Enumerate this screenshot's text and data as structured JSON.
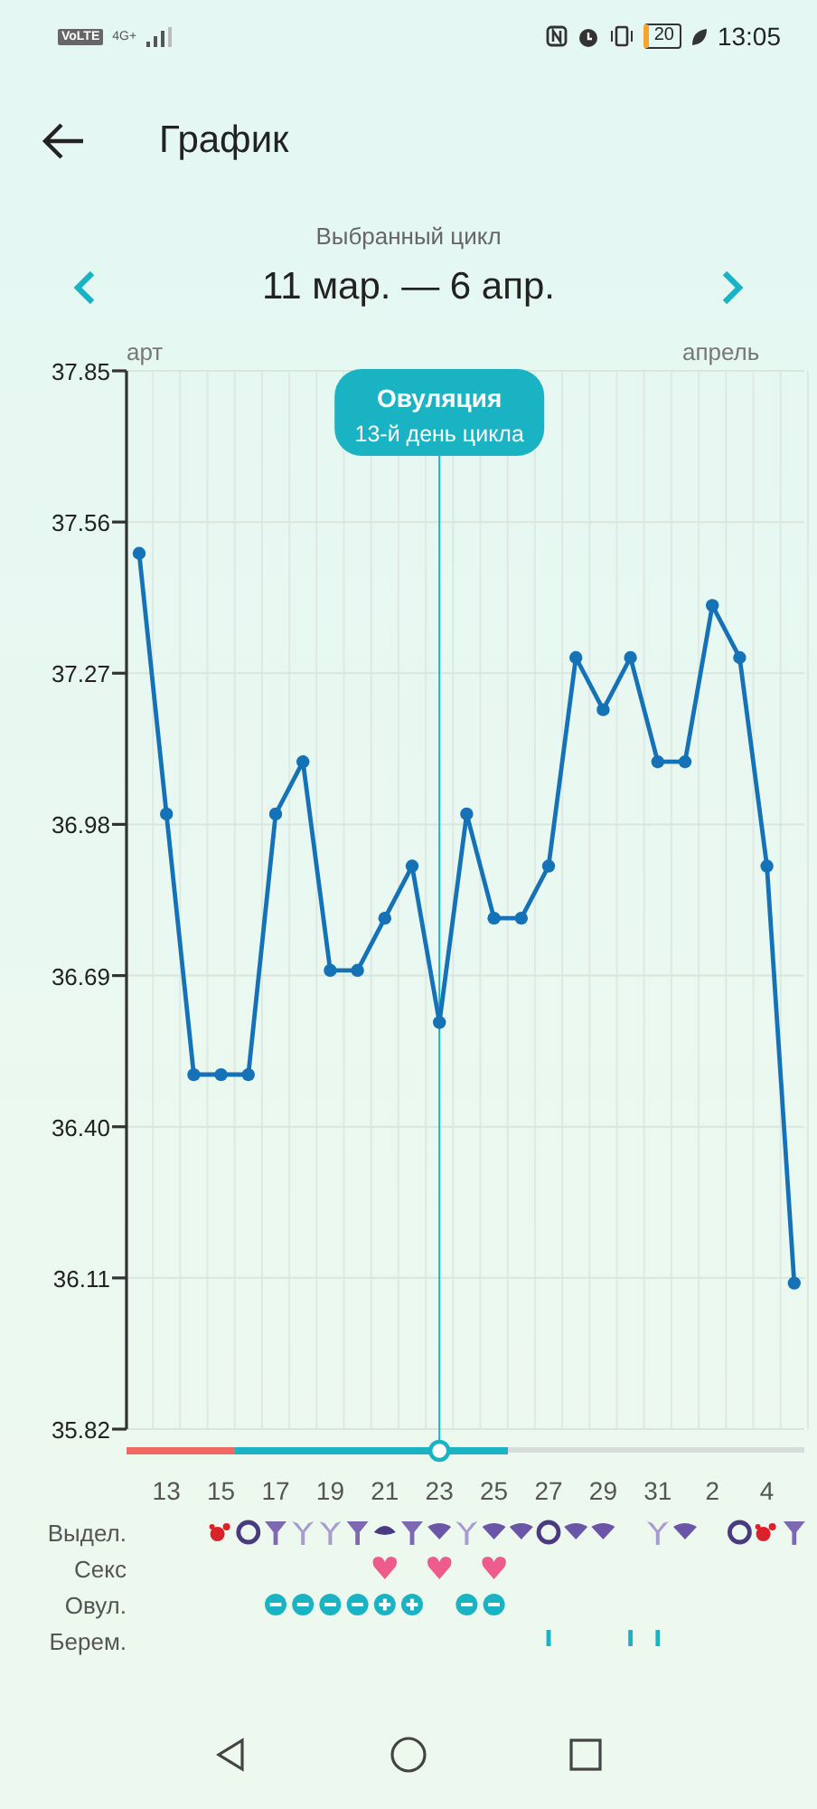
{
  "status_bar": {
    "network_badge": "VoLTE",
    "network_type": "4G+",
    "battery": "20",
    "time": "13:05"
  },
  "header": {
    "title": "График"
  },
  "cycle_selector": {
    "caption": "Выбранный цикл",
    "range": "11 мар. — 6 апр."
  },
  "chart": {
    "month_labels": [
      "арт",
      "апрель"
    ],
    "cycle_bar": [
      {
        "kind": "period"
      },
      {
        "kind": "fertile"
      },
      {
        "kind": "rest"
      }
    ],
    "chart_data": {
      "type": "line",
      "categories": [
        null,
        "13",
        null,
        "15",
        null,
        "17",
        null,
        "19",
        null,
        "21",
        null,
        "23",
        null,
        "25",
        null,
        "27",
        null,
        "29",
        null,
        "31",
        null,
        "2",
        null,
        "4",
        null
      ],
      "ylim": [
        35.82,
        37.85
      ],
      "yticks": [
        {
          "value": 35.82,
          "label": "35.82"
        },
        {
          "value": 36.11,
          "label": "36.11"
        },
        {
          "value": 36.4,
          "label": "36.40"
        },
        {
          "value": 36.69,
          "label": "36.69"
        },
        {
          "value": 36.98,
          "label": "36.98"
        },
        {
          "value": 37.27,
          "label": "37.27"
        },
        {
          "value": 37.56,
          "label": "37.56"
        },
        {
          "value": 37.85,
          "label": "37.85"
        }
      ],
      "grid": true,
      "series": [
        {
          "color": "#1572b6",
          "marker": true,
          "values": [
            37.5,
            37.0,
            36.5,
            36.5,
            36.5,
            37.0,
            37.1,
            36.7,
            36.7,
            36.8,
            36.9,
            36.6,
            37.0,
            36.8,
            36.8,
            36.9,
            37.3,
            37.2,
            37.3,
            37.1,
            37.1,
            37.4,
            37.3,
            36.9,
            36.1
          ]
        }
      ],
      "annotations": [
        "Овуляция",
        "13-й день цикла"
      ]
    }
  },
  "symbol_rows": [
    {
      "label": "Выдел.",
      "cells": [
        {
          "kind": "none"
        },
        {
          "kind": "none"
        },
        {
          "kind": "none"
        },
        {
          "kind": "blood"
        },
        {
          "kind": "ring"
        },
        {
          "kind": "funnel"
        },
        {
          "kind": "funnel_light"
        },
        {
          "kind": "funnel_light"
        },
        {
          "kind": "funnel"
        },
        {
          "kind": "lens"
        },
        {
          "kind": "funnel"
        },
        {
          "kind": "drop"
        },
        {
          "kind": "funnel_light"
        },
        {
          "kind": "drop"
        },
        {
          "kind": "drop"
        },
        {
          "kind": "ring"
        },
        {
          "kind": "drop"
        },
        {
          "kind": "drop"
        },
        {
          "kind": "none"
        },
        {
          "kind": "funnel_light"
        },
        {
          "kind": "drop"
        },
        {
          "kind": "none"
        },
        {
          "kind": "ring"
        },
        {
          "kind": "blood"
        },
        {
          "kind": "funnel"
        }
      ]
    },
    {
      "label": "Секс",
      "cells": [
        {
          "kind": "none"
        },
        {
          "kind": "none"
        },
        {
          "kind": "none"
        },
        {
          "kind": "none"
        },
        {
          "kind": "none"
        },
        {
          "kind": "none"
        },
        {
          "kind": "none"
        },
        {
          "kind": "none"
        },
        {
          "kind": "none"
        },
        {
          "kind": "heart"
        },
        {
          "kind": "none"
        },
        {
          "kind": "heart"
        },
        {
          "kind": "none"
        },
        {
          "kind": "heart"
        },
        {
          "kind": "none"
        },
        {
          "kind": "none"
        },
        {
          "kind": "none"
        },
        {
          "kind": "none"
        },
        {
          "kind": "none"
        },
        {
          "kind": "none"
        },
        {
          "kind": "none"
        },
        {
          "kind": "none"
        },
        {
          "kind": "none"
        },
        {
          "kind": "none"
        },
        {
          "kind": "none"
        }
      ]
    },
    {
      "label": "Овул.",
      "cells": [
        {
          "kind": "none"
        },
        {
          "kind": "none"
        },
        {
          "kind": "none"
        },
        {
          "kind": "none"
        },
        {
          "kind": "none"
        },
        {
          "kind": "negative"
        },
        {
          "kind": "negative"
        },
        {
          "kind": "negative"
        },
        {
          "kind": "negative"
        },
        {
          "kind": "positive"
        },
        {
          "kind": "positive"
        },
        {
          "kind": "none"
        },
        {
          "kind": "negative"
        },
        {
          "kind": "negative"
        },
        {
          "kind": "none"
        },
        {
          "kind": "none"
        },
        {
          "kind": "none"
        },
        {
          "kind": "none"
        },
        {
          "kind": "none"
        },
        {
          "kind": "none"
        },
        {
          "kind": "none"
        },
        {
          "kind": "none"
        },
        {
          "kind": "none"
        },
        {
          "kind": "none"
        },
        {
          "kind": "none"
        }
      ]
    },
    {
      "label": "Берем.",
      "cells": [
        {
          "kind": "none"
        },
        {
          "kind": "none"
        },
        {
          "kind": "none"
        },
        {
          "kind": "none"
        },
        {
          "kind": "none"
        },
        {
          "kind": "none"
        },
        {
          "kind": "none"
        },
        {
          "kind": "none"
        },
        {
          "kind": "none"
        },
        {
          "kind": "none"
        },
        {
          "kind": "none"
        },
        {
          "kind": "none"
        },
        {
          "kind": "none"
        },
        {
          "kind": "none"
        },
        {
          "kind": "none"
        },
        {
          "kind": "test"
        },
        {
          "kind": "none"
        },
        {
          "kind": "none"
        },
        {
          "kind": "test"
        },
        {
          "kind": "test"
        },
        {
          "kind": "none"
        },
        {
          "kind": "none"
        },
        {
          "kind": "none"
        },
        {
          "kind": "none"
        },
        {
          "kind": "none"
        }
      ]
    }
  ]
}
